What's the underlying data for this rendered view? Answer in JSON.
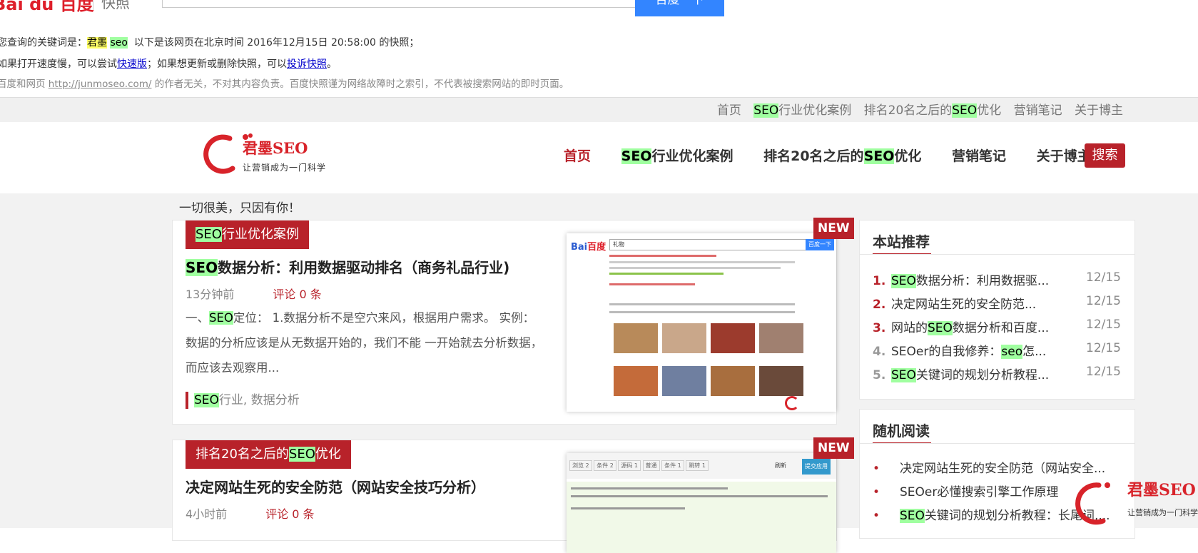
{
  "snapshot": {
    "logo_text": "Bai du 百度",
    "kuaizhao": "快照",
    "button": "百度一下",
    "note1_prefix": "您查询的关键词是：",
    "keyword1": "君墨",
    "keyword2": "seo",
    "note1_suffix": "以下是该网页在北京时间 2016年12月15日 20:58:00 的快照；",
    "note2_a": "如果打开速度慢，可以尝试",
    "note2_link1": "快速版",
    "note2_b": "；如果想更新或删除快照，可以",
    "note2_link2": "投诉快照",
    "note2_c": "。",
    "note3_a": "百度和网页",
    "note3_url": "http://junmoseo.com/",
    "note3_b": "的作者无关，不对其内容负责。百度快照谨为网络故障时之索引，不代表被搜索网站的即时页面。"
  },
  "topnav": {
    "home": "首页",
    "item1_seo": "SEO",
    "item1_rest": "行业优化案例",
    "item2_pre": "排名20名之后的",
    "item2_seo": "SEO",
    "item2_post": "优化",
    "item3": "营销笔记",
    "item4": "关于博主"
  },
  "site": {
    "logo_name": "君墨SEO",
    "logo_slogan": "让营销成为一门科学",
    "nav_home": "首页",
    "nav1_seo": "SEO",
    "nav1_rest": "行业优化案例",
    "nav2_pre": "排名20名之后的",
    "nav2_seo": "SEO",
    "nav2_post": "优化",
    "nav3": "营销笔记",
    "nav4": "关于博主",
    "search": "搜索",
    "tagline": "一切很美，只因有你！",
    "accent": "#b8222a"
  },
  "posts": [
    {
      "category_seo": "SEO",
      "category_rest": "行业优化案例",
      "title_seo": "SEO",
      "title_rest": "数据分析：利用数据驱动排名（商务礼品行业)",
      "time": "13分钟前",
      "comments": "评论 0 条",
      "excerpt_a": "一、",
      "excerpt_seo": "SEO",
      "excerpt_b": "定位： 1.数据分析不是空穴来风，根据用户需求。 实例： 数据的分析应该是从无数据开始的，我们不能 一开始就去分析数据，而应该去观察用...",
      "tags_seo": "SEO",
      "tags_rest": "行业, 数据分析",
      "badge": "NEW",
      "thumb_search": "礼物",
      "thumb_btn": "百度一下"
    },
    {
      "category_pre": "排名20名之后的",
      "category_seo": "SEO",
      "category_post": "优化",
      "title": "决定网站生死的安全防范（网站安全技巧分析）",
      "time": "4小时前",
      "comments": "评论 0 条",
      "badge": "NEW",
      "thumb_tabs": [
        "浏览 2",
        "条件 2",
        "源码 1",
        "普通",
        "条件 1",
        "跳转 1"
      ],
      "thumb_refresh": "刷新",
      "thumb_btn": "提交应用"
    }
  ],
  "sidebar": {
    "recommend_title": "本站推荐",
    "recommend": [
      {
        "num": "1.",
        "seo": "SEO",
        "text": "数据分析：利用数据驱...",
        "date": "12/15"
      },
      {
        "num": "2.",
        "seo": "",
        "text": "决定网站生死的安全防范...",
        "date": "12/15"
      },
      {
        "num": "3.",
        "pre": "网站的",
        "seo": "SEO",
        "text": "数据分析和百度...",
        "date": "12/15"
      },
      {
        "num": "4.",
        "pre": "SEOer的自我修养：",
        "seo": "seo",
        "text": "怎...",
        "date": "12/15"
      },
      {
        "num": "5.",
        "seo": "SEO",
        "text": "关键词的规划分析教程...",
        "date": "12/15"
      }
    ],
    "random_title": "随机阅读",
    "random": [
      {
        "pre": "决定网站生死的安全防范（网站安全..."
      },
      {
        "pre": "SEOer必懂搜索引擎工作原理"
      },
      {
        "seo": "SEO",
        "pre": "关键词的规划分析教程：长尾词,..."
      }
    ]
  },
  "watermark": {
    "name": "君墨SEO",
    "slogan": "让营销成为一门科学"
  }
}
